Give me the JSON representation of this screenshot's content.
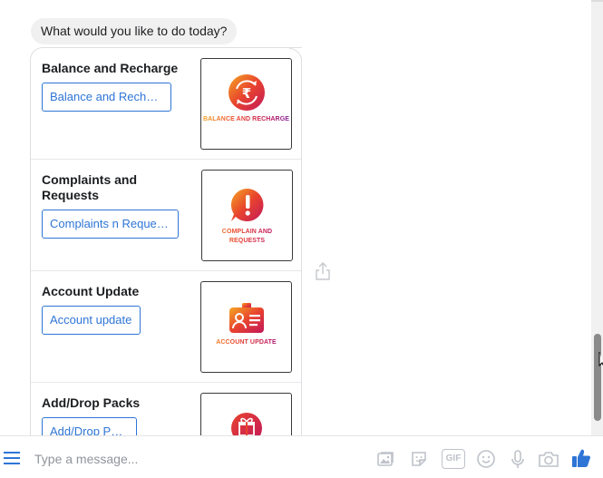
{
  "chat": {
    "prompt": "What would you like to do today?",
    "cards": [
      {
        "title": "Balance and Recharge",
        "button": "Balance and Recharge",
        "image_caption": "BALANCE AND RECHARGE",
        "image_icon": "rupee-refresh-icon"
      },
      {
        "title": "Complaints and Requests",
        "button": "Complaints n Request...",
        "image_caption_line1": "COMPLAIN AND",
        "image_caption_line2": "REQUESTS",
        "image_icon": "exclamation-speech-icon"
      },
      {
        "title": "Account Update",
        "button": "Account update",
        "image_caption": "ACCOUNT UPDATE",
        "image_icon": "id-card-icon"
      },
      {
        "title": "Add/Drop Packs",
        "button": "Add/Drop Pack",
        "image_icon": "gift-box-icon"
      }
    ],
    "share_icon": "share-icon"
  },
  "composer": {
    "placeholder": "Type a message...",
    "icons": [
      "menu-icon",
      "image-icon",
      "sticker-icon",
      "gif-icon",
      "emoji-icon",
      "microphone-icon",
      "camera-icon",
      "thumbs-up-icon"
    ],
    "gif_label": "GIF"
  },
  "colors": {
    "accent": "#2e75d6",
    "brand_red": "#e8432e",
    "brand_magenta": "#c2185b",
    "bubble_bg": "#f1f0f0"
  }
}
